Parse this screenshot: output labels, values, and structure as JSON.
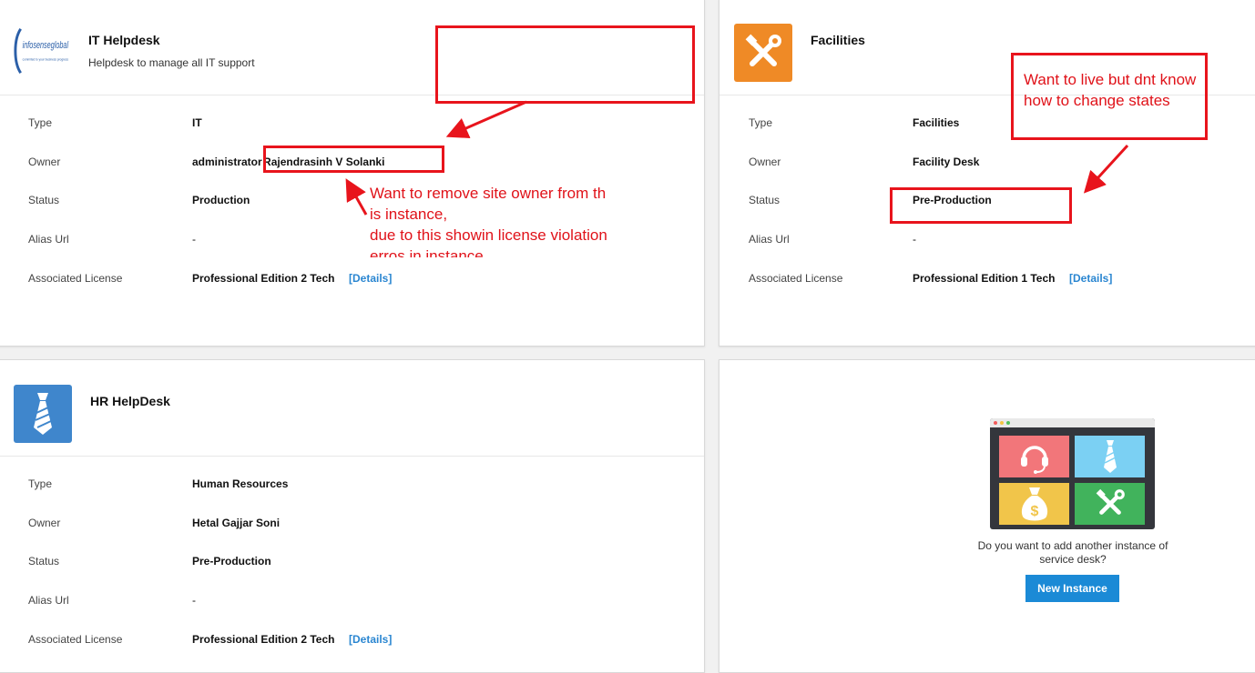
{
  "labels": {
    "type": "Type",
    "owner": "Owner",
    "status": "Status",
    "alias": "Alias Url",
    "license": "Associated License",
    "details": "[Details]"
  },
  "cards": [
    {
      "title": "IT Helpdesk",
      "subtitle": "Helpdesk to manage all IT support",
      "logo_text": "infosenseglobal",
      "logo_tagline": "commited to your business progress",
      "type": "IT",
      "owner_prefix": "administrator",
      "owner_name": "Rajendrasinh V Solanki",
      "status": "Production",
      "alias": "-",
      "license": "Professional Edition 2 Tech"
    },
    {
      "title": "Facilities",
      "type": "Facilities",
      "owner": "Facility Desk",
      "status": "Pre-Production",
      "alias": "-",
      "license": "Professional Edition 1 Tech",
      "accent": "#ef8a26"
    },
    {
      "title": "HR HelpDesk",
      "type": "Human Resources",
      "owner": "Hetal Gajjar Soni",
      "status": "Pre-Production",
      "alias": "-",
      "license": "Professional Edition 2 Tech",
      "accent": "#3f86cc"
    }
  ],
  "new_instance": {
    "prompt_line1": "Do you want to add another instance of",
    "prompt_line2": "service desk?",
    "button_label": "New Instance",
    "tile_colors": [
      "#f2767a",
      "#7bd0f3",
      "#f1c54a",
      "#41b35c"
    ]
  },
  "annotations": {
    "remove_owner_line1": "Want to remove site owner from th",
    "remove_owner_line2": "is instance,",
    "remove_owner_line3": "due to this showin license violation",
    "remove_owner_line4": "erros in instance",
    "go_live_line1": "Want to live but dnt know",
    "go_live_line2": "how to change states",
    "color": "#e8141c"
  }
}
